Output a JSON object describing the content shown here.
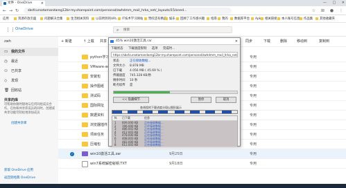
{
  "browser": {
    "tab_title": "文件 - OneDrive",
    "url": "sbsfcursotamandareg12br-my.sharepoint.com/personal/zwhdmm_mail_hrka_net/_layouts/15/oned...",
    "window_controls": [
      "—",
      "□",
      "✕"
    ],
    "bookmarks": [
      "应用",
      "资源存放页面",
      "问题解决合集",
      "生活相关资料",
      "以前用到的URL",
      "IT技术学习网站",
      "赞叹还有精品",
      "娱乐",
      "回顾了工作感兴趣",
      "指南",
      "我的",
      "数据库平台",
      "Apk",
      "相关链接",
      "本人账号信息",
      "作品集",
      "其他收藏夹"
    ]
  },
  "onedrive": {
    "app_name": "OneDrive",
    "search_placeholder": "搜索",
    "user": "zwh",
    "nav": [
      {
        "label": "我的文件",
        "icon": "folder-icon",
        "active": true
      },
      {
        "label": "最近",
        "icon": "clock-icon",
        "active": false
      },
      {
        "label": "已共享",
        "icon": "people-icon",
        "active": false
      },
      {
        "label": "发现",
        "icon": "diamond-icon",
        "active": false
      },
      {
        "label": "回收站",
        "icon": "trash-icon",
        "active": false
      }
    ],
    "shared_library": {
      "title": "共享的库",
      "description": "可帮助你随时随地与任何同组成员合作。在你和共享库成员的同时，创建或共享功能可轻松地添加成员",
      "create_link": "创建共享库"
    },
    "get_apps": "获取 OneDrive 应用",
    "back_classic": "返回到经典 OneDrive",
    "commands": [
      "+ 新建",
      "↑ 上载",
      "共享",
      "复制链接",
      "同步",
      "下载",
      "删除",
      "移动到",
      "复制到"
    ],
    "files": [
      {
        "name": "python学习资料",
        "date": "",
        "by": "",
        "size": "",
        "share": "专用",
        "type": "folder"
      },
      {
        "name": "VMware-workstation",
        "date": "",
        "by": "",
        "size": "",
        "share": "专用",
        "type": "folder"
      },
      {
        "name": "安装包",
        "date": "",
        "by": "",
        "size": "",
        "share": "专用",
        "type": "folder"
      },
      {
        "name": "操作图纸",
        "date": "",
        "by": "",
        "size": "",
        "share": "专用",
        "type": "folder"
      },
      {
        "name": "测试码",
        "date": "",
        "by": "",
        "size": "",
        "share": "专用",
        "type": "folder"
      },
      {
        "name": "国际网址",
        "date": "",
        "by": "",
        "size": "",
        "share": "专用",
        "type": "folder"
      },
      {
        "name": "数据资料",
        "date": "",
        "by": "",
        "size": "",
        "share": "专用",
        "type": "folder"
      },
      {
        "name": "浏览器插件",
        "date": "",
        "by": "",
        "size": "",
        "share": "专用",
        "type": "folder"
      },
      {
        "name": "项目任务",
        "date": "",
        "by": "",
        "size": "",
        "share": "专用",
        "type": "folder"
      },
      {
        "name": "压缩包",
        "date": "",
        "by": "",
        "size": "",
        "share": "专用",
        "type": "folder"
      },
      {
        "name": "win10激活工具.zar",
        "date": "9月25日",
        "by": "",
        "size": "",
        "share": "专用",
        "type": "zip",
        "selected": true
      },
      {
        "name": "win7系统解密秘钥.TXT",
        "date": "9月18日",
        "by": "",
        "size": "",
        "share": "专用",
        "type": "txt"
      }
    ]
  },
  "download_dialog": {
    "title": "45% win10激活工具.rar",
    "close": "✕",
    "tabs": [
      "下载状态",
      "下载速度限制",
      "选项",
      "完成时…"
    ],
    "url": "https://sbsfcursotamandareg12br-my.sharepoint.com/personal/zwhdmm_mail_hrka_net/...",
    "status_label": "状态",
    "status_value": "正在接收数据...",
    "fields": [
      {
        "k": "文件大小",
        "v": "8.878 MB"
      },
      {
        "k": "已下载",
        "v": "4.056 MB  ( 45.69 % )"
      },
      {
        "k": "传输速度",
        "v": "745.328 KB/秒"
      },
      {
        "k": "剩余时间",
        "v": "10 秒"
      },
      {
        "k": "断点续传",
        "v": "是"
      }
    ],
    "progress": 0.4569,
    "buttons": [
      "<< 隐藏细节",
      "暂停",
      "取消"
    ],
    "segments_note": "各线程的下载进度分段以图形展示",
    "threads_header": [
      "N.",
      "已下载",
      "信息"
    ],
    "threads": [
      {
        "n": "1",
        "downloaded": "609.000 KB",
        "info": "正在接收数据..."
      },
      {
        "n": "2",
        "downloaded": "196.000 KB",
        "info": "正在接收数据..."
      },
      {
        "n": "3",
        "downloaded": "486.003 KB",
        "info": "正在接收数据..."
      },
      {
        "n": "4",
        "downloaded": "412.003 KB",
        "info": "正在接收数据..."
      },
      {
        "n": "5",
        "downloaded": "478.000 KB",
        "info": "正在接收数据..."
      },
      {
        "n": "6",
        "downloaded": "408.003 KB",
        "info": "正在接收数据..."
      },
      {
        "n": "7",
        "downloaded": "483.000 KB",
        "info": "正在接收数据..."
      },
      {
        "n": "8",
        "downloaded": "612.003 KB",
        "info": "正在接收数据..."
      }
    ]
  }
}
